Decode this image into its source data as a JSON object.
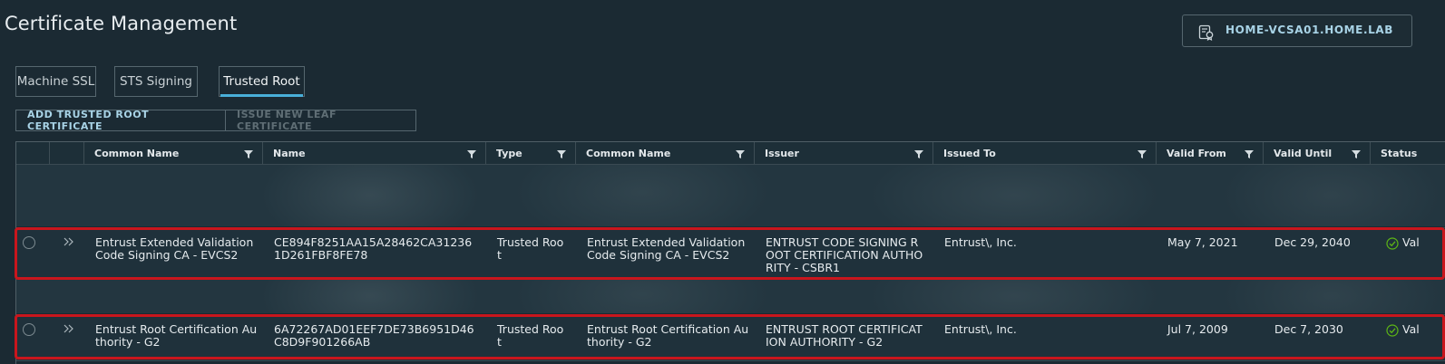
{
  "page": {
    "title": "Certificate Management"
  },
  "vcenter": {
    "label": "HOME-VCSA01.HOME.LAB",
    "icon": "server-certificate-icon"
  },
  "tabs": [
    {
      "label": "Machine SSL",
      "active": false
    },
    {
      "label": "STS Signing",
      "active": false
    },
    {
      "label": "Trusted Root",
      "active": true
    }
  ],
  "actions": {
    "add_trusted_root": "ADD TRUSTED ROOT CERTIFICATE",
    "issue_leaf": "ISSUE NEW LEAF CERTIFICATE"
  },
  "table": {
    "columns": [
      "Common Name",
      "Name",
      "Type",
      "Common Name",
      "Issuer",
      "Issued To",
      "Valid From",
      "Valid Until",
      "Status"
    ],
    "rows": [
      {
        "common_name": "Entrust Extended Validation Code Signing CA - EVCS2",
        "name": "CE894F8251AA15A28462CA312361D261FBF8FE78",
        "type": "Trusted Root",
        "common_name_2": "Entrust Extended Validation Code Signing CA - EVCS2",
        "issuer": "ENTRUST CODE SIGNING ROOT CERTIFICATION AUTHORITY - CSBR1",
        "issued_to": "Entrust\\, Inc.",
        "valid_from": "May 7, 2021",
        "valid_until": "Dec 29, 2040",
        "status": "Val"
      },
      {
        "common_name": "Entrust Root Certification Authority - G2",
        "name": "6A72267AD01EEF7DE73B6951D46C8D9F901266AB",
        "type": "Trusted Root",
        "common_name_2": "Entrust Root Certification Authority - G2",
        "issuer": "ENTRUST ROOT CERTIFICATION AUTHORITY - G2",
        "issued_to": "Entrust\\, Inc.",
        "valid_from": "Jul 7, 2009",
        "valid_until": "Dec 7, 2030",
        "status": "Val"
      }
    ]
  },
  "colors": {
    "accent": "#49afd9",
    "highlight": "#c9161d",
    "valid": "#5eb715"
  }
}
